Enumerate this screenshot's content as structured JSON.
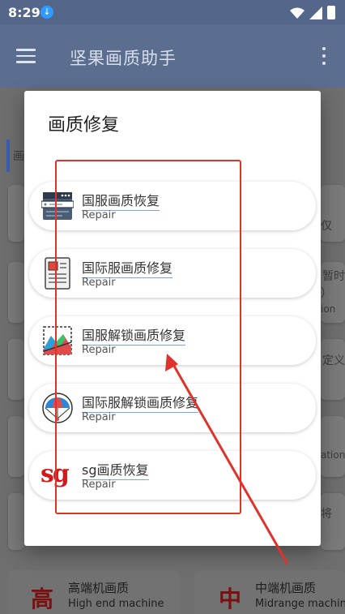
{
  "status_bar": {
    "time": "8:29"
  },
  "app_bar": {
    "title": "坚果画质助手"
  },
  "background": {
    "partial_texts": [
      "画",
      "仅",
      "暂时",
      "）",
      "ion",
      "定义",
      "ation",
      "将"
    ],
    "bottom_cards": [
      {
        "glyph": "高",
        "title": "高端机画质",
        "subtitle": "High end machine"
      },
      {
        "glyph": "中",
        "title": "中端机画质",
        "subtitle": "Midrange machin"
      }
    ]
  },
  "dialog": {
    "title": "画质修复",
    "options": [
      {
        "label": "国服画质恢复",
        "sub": "Repair",
        "icon": "browser-window-icon"
      },
      {
        "label": "国际服画质修复",
        "sub": "Repair",
        "icon": "document-icon"
      },
      {
        "label": "国服解锁画质修复",
        "sub": "Repair",
        "icon": "picture-icon"
      },
      {
        "label": "国际服解锁画质修复",
        "sub": "Repair",
        "icon": "parachute-icon"
      },
      {
        "label": "sg画质恢复",
        "sub": "Repair",
        "icon": "sg-logo-icon",
        "logo_text": "sg"
      }
    ]
  },
  "annotation_colors": {
    "highlight": "#e0322a"
  }
}
